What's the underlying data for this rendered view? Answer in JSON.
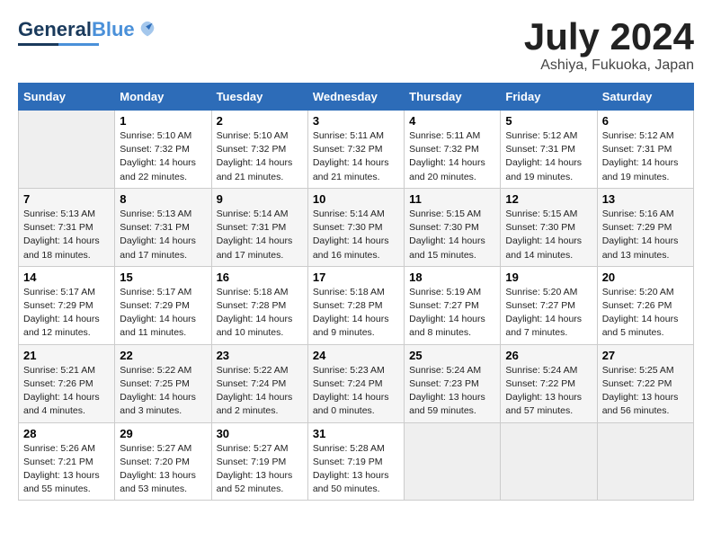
{
  "header": {
    "logo_general": "General",
    "logo_blue": "Blue",
    "title": "July 2024",
    "location": "Ashiya, Fukuoka, Japan"
  },
  "days_of_week": [
    "Sunday",
    "Monday",
    "Tuesday",
    "Wednesday",
    "Thursday",
    "Friday",
    "Saturday"
  ],
  "weeks": [
    [
      {
        "day": "",
        "sunrise": "",
        "sunset": "",
        "daylight": ""
      },
      {
        "day": "1",
        "sunrise": "5:10 AM",
        "sunset": "7:32 PM",
        "daylight": "14 hours and 22 minutes."
      },
      {
        "day": "2",
        "sunrise": "5:10 AM",
        "sunset": "7:32 PM",
        "daylight": "14 hours and 21 minutes."
      },
      {
        "day": "3",
        "sunrise": "5:11 AM",
        "sunset": "7:32 PM",
        "daylight": "14 hours and 21 minutes."
      },
      {
        "day": "4",
        "sunrise": "5:11 AM",
        "sunset": "7:32 PM",
        "daylight": "14 hours and 20 minutes."
      },
      {
        "day": "5",
        "sunrise": "5:12 AM",
        "sunset": "7:31 PM",
        "daylight": "14 hours and 19 minutes."
      },
      {
        "day": "6",
        "sunrise": "5:12 AM",
        "sunset": "7:31 PM",
        "daylight": "14 hours and 19 minutes."
      }
    ],
    [
      {
        "day": "7",
        "sunrise": "5:13 AM",
        "sunset": "7:31 PM",
        "daylight": "14 hours and 18 minutes."
      },
      {
        "day": "8",
        "sunrise": "5:13 AM",
        "sunset": "7:31 PM",
        "daylight": "14 hours and 17 minutes."
      },
      {
        "day": "9",
        "sunrise": "5:14 AM",
        "sunset": "7:31 PM",
        "daylight": "14 hours and 17 minutes."
      },
      {
        "day": "10",
        "sunrise": "5:14 AM",
        "sunset": "7:30 PM",
        "daylight": "14 hours and 16 minutes."
      },
      {
        "day": "11",
        "sunrise": "5:15 AM",
        "sunset": "7:30 PM",
        "daylight": "14 hours and 15 minutes."
      },
      {
        "day": "12",
        "sunrise": "5:15 AM",
        "sunset": "7:30 PM",
        "daylight": "14 hours and 14 minutes."
      },
      {
        "day": "13",
        "sunrise": "5:16 AM",
        "sunset": "7:29 PM",
        "daylight": "14 hours and 13 minutes."
      }
    ],
    [
      {
        "day": "14",
        "sunrise": "5:17 AM",
        "sunset": "7:29 PM",
        "daylight": "14 hours and 12 minutes."
      },
      {
        "day": "15",
        "sunrise": "5:17 AM",
        "sunset": "7:29 PM",
        "daylight": "14 hours and 11 minutes."
      },
      {
        "day": "16",
        "sunrise": "5:18 AM",
        "sunset": "7:28 PM",
        "daylight": "14 hours and 10 minutes."
      },
      {
        "day": "17",
        "sunrise": "5:18 AM",
        "sunset": "7:28 PM",
        "daylight": "14 hours and 9 minutes."
      },
      {
        "day": "18",
        "sunrise": "5:19 AM",
        "sunset": "7:27 PM",
        "daylight": "14 hours and 8 minutes."
      },
      {
        "day": "19",
        "sunrise": "5:20 AM",
        "sunset": "7:27 PM",
        "daylight": "14 hours and 7 minutes."
      },
      {
        "day": "20",
        "sunrise": "5:20 AM",
        "sunset": "7:26 PM",
        "daylight": "14 hours and 5 minutes."
      }
    ],
    [
      {
        "day": "21",
        "sunrise": "5:21 AM",
        "sunset": "7:26 PM",
        "daylight": "14 hours and 4 minutes."
      },
      {
        "day": "22",
        "sunrise": "5:22 AM",
        "sunset": "7:25 PM",
        "daylight": "14 hours and 3 minutes."
      },
      {
        "day": "23",
        "sunrise": "5:22 AM",
        "sunset": "7:24 PM",
        "daylight": "14 hours and 2 minutes."
      },
      {
        "day": "24",
        "sunrise": "5:23 AM",
        "sunset": "7:24 PM",
        "daylight": "14 hours and 0 minutes."
      },
      {
        "day": "25",
        "sunrise": "5:24 AM",
        "sunset": "7:23 PM",
        "daylight": "13 hours and 59 minutes."
      },
      {
        "day": "26",
        "sunrise": "5:24 AM",
        "sunset": "7:22 PM",
        "daylight": "13 hours and 57 minutes."
      },
      {
        "day": "27",
        "sunrise": "5:25 AM",
        "sunset": "7:22 PM",
        "daylight": "13 hours and 56 minutes."
      }
    ],
    [
      {
        "day": "28",
        "sunrise": "5:26 AM",
        "sunset": "7:21 PM",
        "daylight": "13 hours and 55 minutes."
      },
      {
        "day": "29",
        "sunrise": "5:27 AM",
        "sunset": "7:20 PM",
        "daylight": "13 hours and 53 minutes."
      },
      {
        "day": "30",
        "sunrise": "5:27 AM",
        "sunset": "7:19 PM",
        "daylight": "13 hours and 52 minutes."
      },
      {
        "day": "31",
        "sunrise": "5:28 AM",
        "sunset": "7:19 PM",
        "daylight": "13 hours and 50 minutes."
      },
      {
        "day": "",
        "sunrise": "",
        "sunset": "",
        "daylight": ""
      },
      {
        "day": "",
        "sunrise": "",
        "sunset": "",
        "daylight": ""
      },
      {
        "day": "",
        "sunrise": "",
        "sunset": "",
        "daylight": ""
      }
    ]
  ]
}
